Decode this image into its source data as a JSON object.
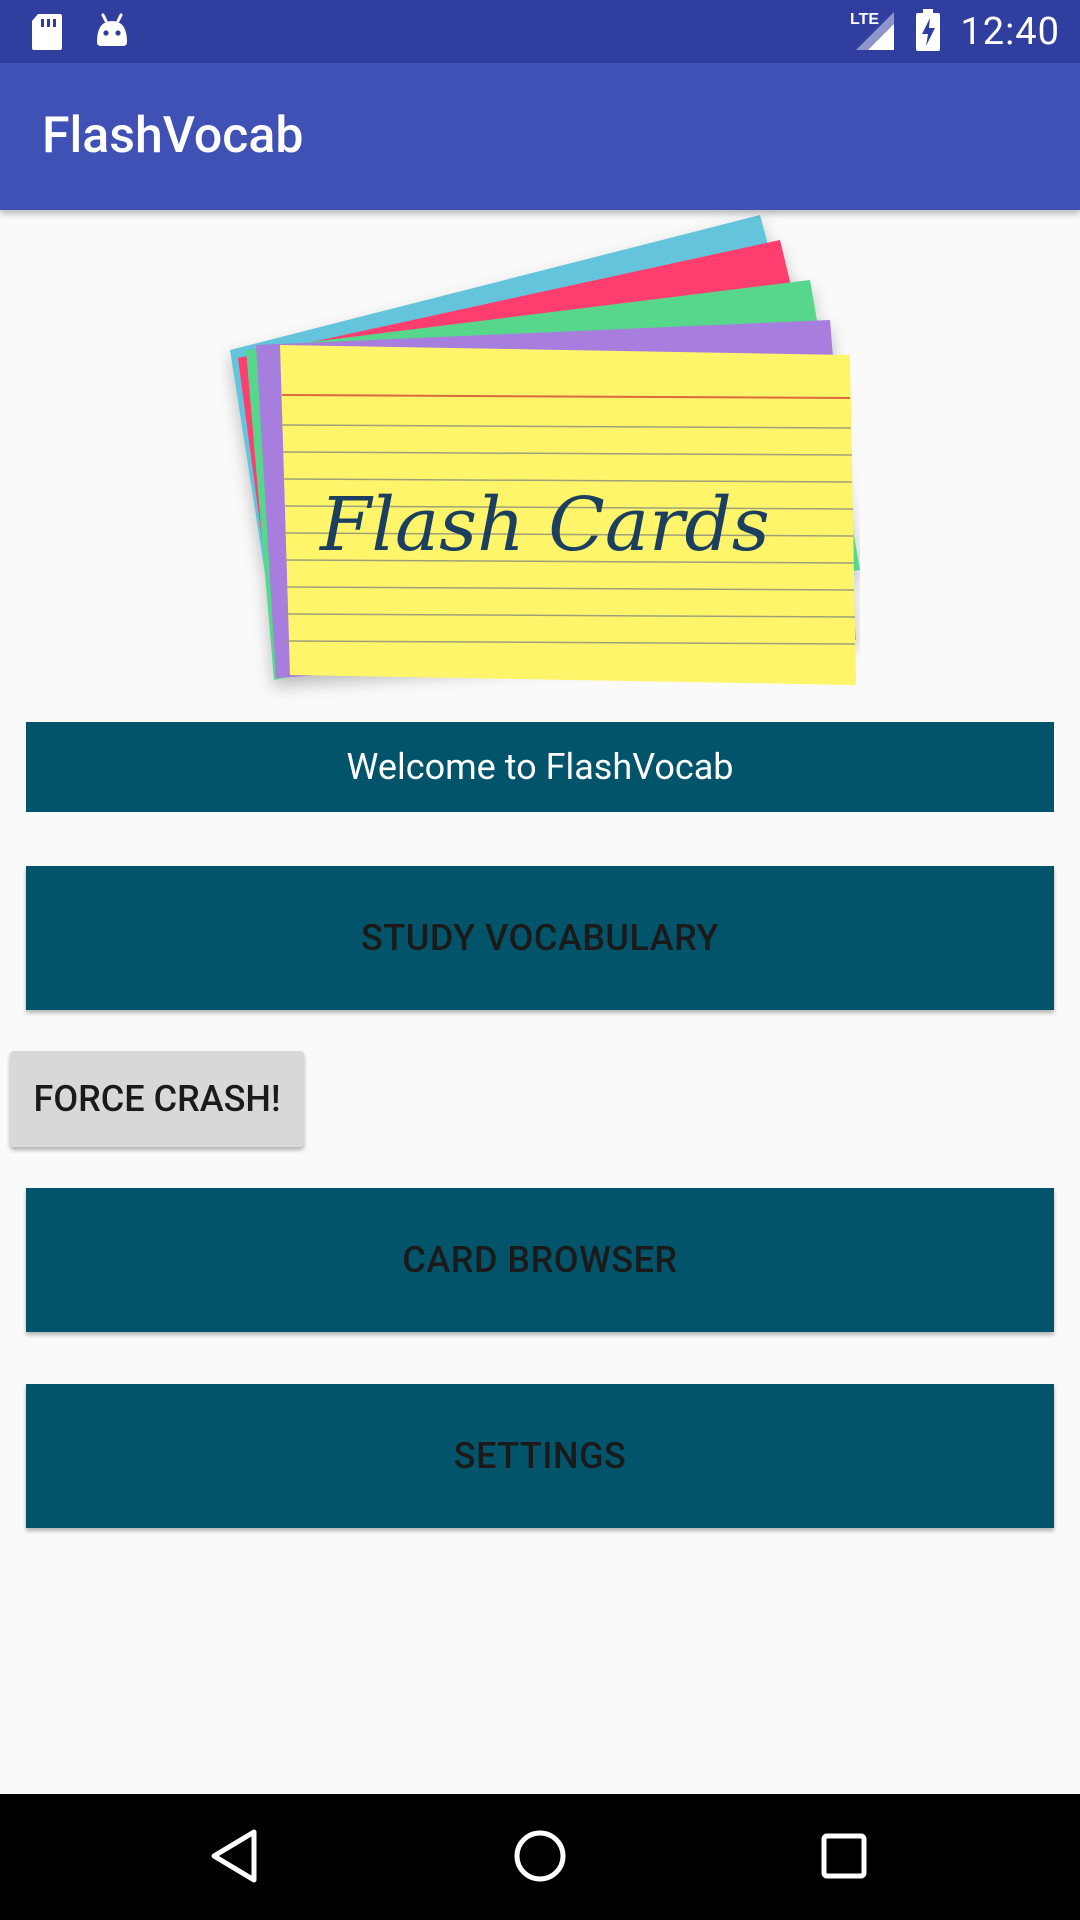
{
  "status_bar": {
    "time": "12:40",
    "network": "LTE",
    "icons": [
      "sd-card-icon",
      "android-icon",
      "lte-signal-icon",
      "battery-charging-icon"
    ]
  },
  "app_bar": {
    "title": "FlashVocab"
  },
  "hero": {
    "caption": "Flash Cards"
  },
  "welcome": {
    "text": "Welcome to FlashVocab"
  },
  "buttons": {
    "study": "STUDY VOCABULARY",
    "crash": "FORCE CRASH!",
    "browser": "CARD BROWSER",
    "settings": "SETTINGS"
  },
  "nav_bar": {
    "icons": [
      "back-icon",
      "home-icon",
      "recents-icon"
    ]
  },
  "colors": {
    "status_bar": "#303f9f",
    "app_bar": "#3f51b5",
    "primary_button": "#01546a",
    "secondary_button": "#d8d8d8",
    "background": "#fafafa"
  }
}
